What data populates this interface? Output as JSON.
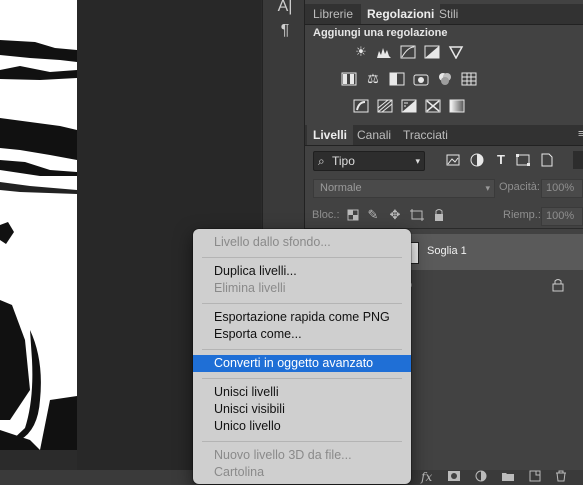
{
  "toolstrip": {
    "glyphs": [
      "A|",
      "¶"
    ]
  },
  "panel_tabs_top": [
    "Librerie",
    "Regolazioni",
    "Stili"
  ],
  "adjustments": {
    "title": "Aggiungi una regolazione",
    "icons": [
      "brightness-contrast-icon",
      "levels-icon",
      "curves-icon",
      "exposure-icon",
      "vibrance-icon",
      "hue-saturation-icon",
      "color-balance-icon",
      "black-white-icon",
      "photo-filter-icon",
      "channel-mixer-icon",
      "color-lookup-icon",
      "invert-icon",
      "posterize-icon",
      "threshold-icon",
      "selective-color-icon",
      "gradient-map-icon"
    ]
  },
  "panel_tabs_layers": [
    "Livelli",
    "Canali",
    "Tracciati"
  ],
  "layers": {
    "filter_label": "Tipo",
    "mode": "Normale",
    "opacity_label": "Opacità:",
    "opacity_value": "100%",
    "lock_label": "Bloc.:",
    "fill_label": "Riemp.:",
    "fill_value": "100%",
    "items": [
      {
        "name": "Soglia 1"
      },
      {
        "name": "o"
      }
    ]
  },
  "context_menu": {
    "groups": [
      [
        {
          "label": "Livello dallo sfondo...",
          "disabled": true
        }
      ],
      [
        {
          "label": "Duplica livelli...",
          "disabled": false
        },
        {
          "label": "Elimina livelli",
          "disabled": true
        }
      ],
      [
        {
          "label": "Esportazione rapida come PNG",
          "disabled": false
        },
        {
          "label": "Esporta come...",
          "disabled": false
        }
      ],
      [
        {
          "label": "Converti in oggetto avanzato",
          "disabled": false,
          "highlighted": true
        }
      ],
      [
        {
          "label": "Unisci livelli",
          "disabled": false
        },
        {
          "label": "Unisci visibili",
          "disabled": false
        },
        {
          "label": "Unico livello",
          "disabled": false
        }
      ],
      [
        {
          "label": "Nuovo livello 3D da file...",
          "disabled": true
        },
        {
          "label": "Cartolina",
          "disabled": true
        }
      ]
    ]
  },
  "colors": {
    "highlight": "#1f6fd6",
    "panel_bg": "#424242",
    "menu_bg": "#cfcfcf"
  }
}
